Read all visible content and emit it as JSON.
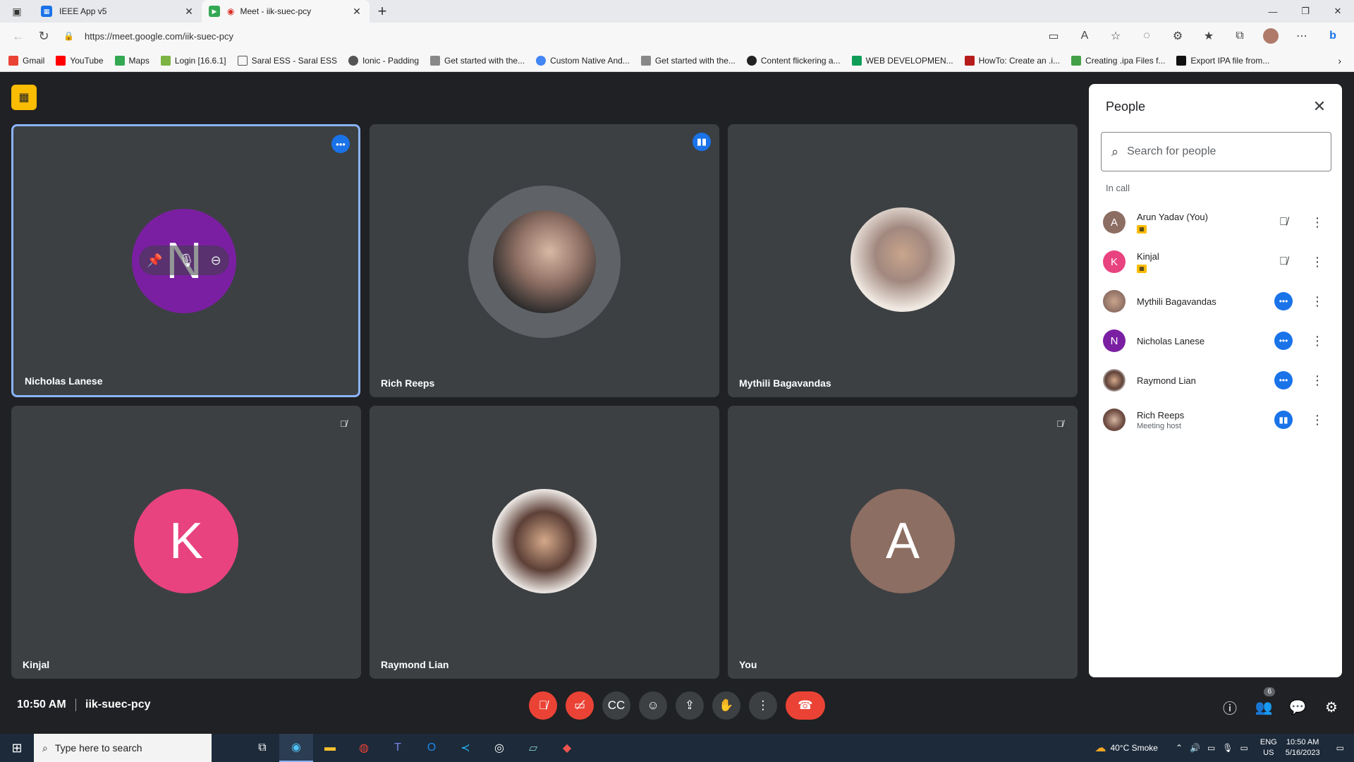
{
  "browser": {
    "tabs": [
      {
        "title": "IEEE App v5",
        "active": false
      },
      {
        "title": "Meet - iik-suec-pcy",
        "active": true
      }
    ],
    "url": "https://meet.google.com/iik-suec-pcy",
    "bookmarks": [
      "Gmail",
      "YouTube",
      "Maps",
      "Login [16.6.1]",
      "Saral ESS - Saral ESS",
      "Ionic - Padding",
      "Get started with the...",
      "Custom Native And...",
      "Get started with the...",
      "Content flickering a...",
      "WEB DEVELOPMEN...",
      "HowTo: Create an .i...",
      "Creating .ipa Files f...",
      "Export IPA file from..."
    ]
  },
  "tiles": [
    {
      "name": "Nicholas Lanese",
      "initial": "N",
      "color": "#7b1fa2",
      "indicator": "more"
    },
    {
      "name": "Rich Reeps",
      "initial": "",
      "color": "#5f6368",
      "indicator": "speaking"
    },
    {
      "name": "Mythili Bagavandas",
      "initial": "",
      "color": "#d7ccc8",
      "indicator": ""
    },
    {
      "name": "Kinjal",
      "initial": "K",
      "color": "#e8437f",
      "indicator": "muted"
    },
    {
      "name": "Raymond Lian",
      "initial": "",
      "color": "#efebe9",
      "indicator": ""
    },
    {
      "name": "You",
      "initial": "A",
      "color": "#8d6e63",
      "indicator": "muted"
    }
  ],
  "people": {
    "title": "People",
    "search_placeholder": "Search for people",
    "section": "In call",
    "list": [
      {
        "name": "Arun Yadav (You)",
        "sub": "",
        "initial": "A",
        "color": "#8d6e63",
        "status": "muted"
      },
      {
        "name": "Kinjal",
        "sub": "",
        "initial": "K",
        "color": "#e8437f",
        "status": "muted"
      },
      {
        "name": "Mythili Bagavandas",
        "sub": "",
        "initial": "",
        "color": "#a1887f",
        "status": "more"
      },
      {
        "name": "Nicholas Lanese",
        "sub": "",
        "initial": "N",
        "color": "#7b1fa2",
        "status": "more"
      },
      {
        "name": "Raymond Lian",
        "sub": "",
        "initial": "",
        "color": "#bcaaa4",
        "status": "more"
      },
      {
        "name": "Rich Reeps",
        "sub": "Meeting host",
        "initial": "",
        "color": "#6d4c41",
        "status": "speaking"
      }
    ]
  },
  "meeting": {
    "time": "10:50 AM",
    "code": "iik-suec-pcy",
    "participant_count": "6"
  },
  "taskbar": {
    "search_placeholder": "Type here to search",
    "weather": "40°C  Smoke",
    "lang1": "ENG",
    "lang2": "US",
    "time": "10:50 AM",
    "date": "5/16/2023"
  }
}
